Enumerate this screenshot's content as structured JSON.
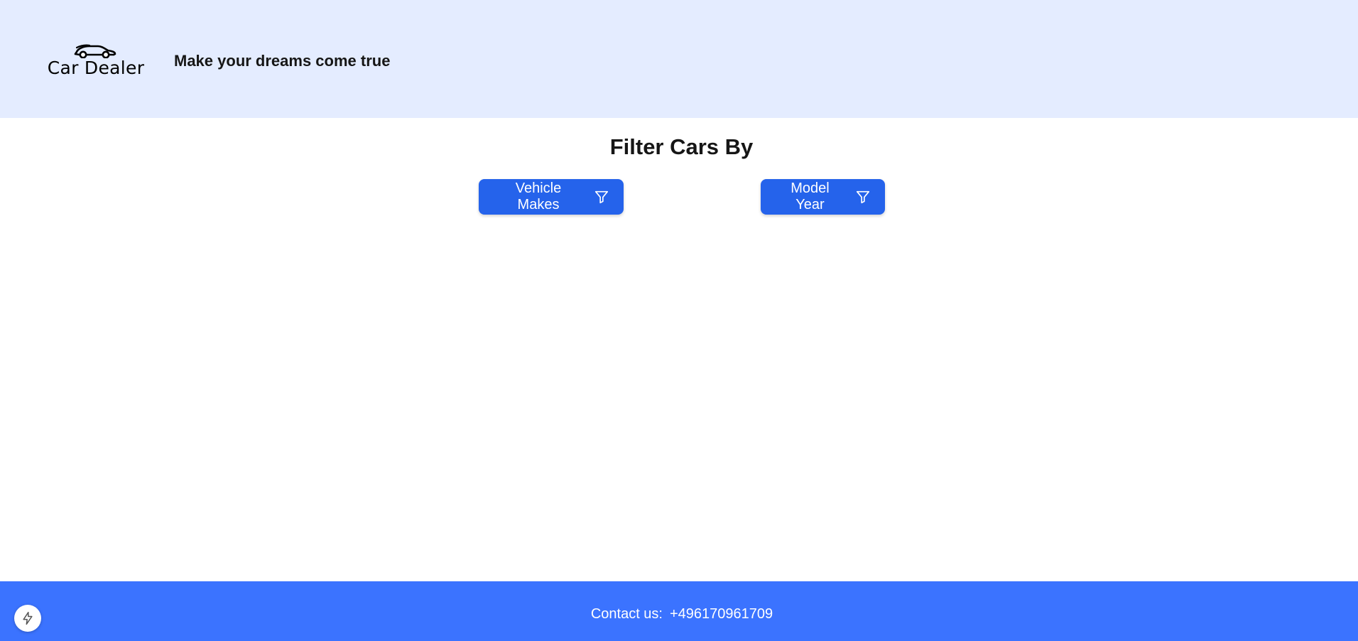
{
  "header": {
    "logo_text": "Car Dealer",
    "logo_icon": "car-icon",
    "tagline": "Make your dreams come true",
    "background": "#e4ecff"
  },
  "filters": {
    "title": "Filter Cars By",
    "buttons": [
      {
        "label": "Vehicle Makes",
        "icon": "filter-icon"
      },
      {
        "label": "Model Year",
        "icon": "filter-icon"
      }
    ],
    "button_color": "#2563eb"
  },
  "footer": {
    "contact_label": "Contact us:",
    "contact_phone": "+496170961709",
    "background": "#3b73ff"
  },
  "floating_button": {
    "icon": "lightning-icon"
  }
}
